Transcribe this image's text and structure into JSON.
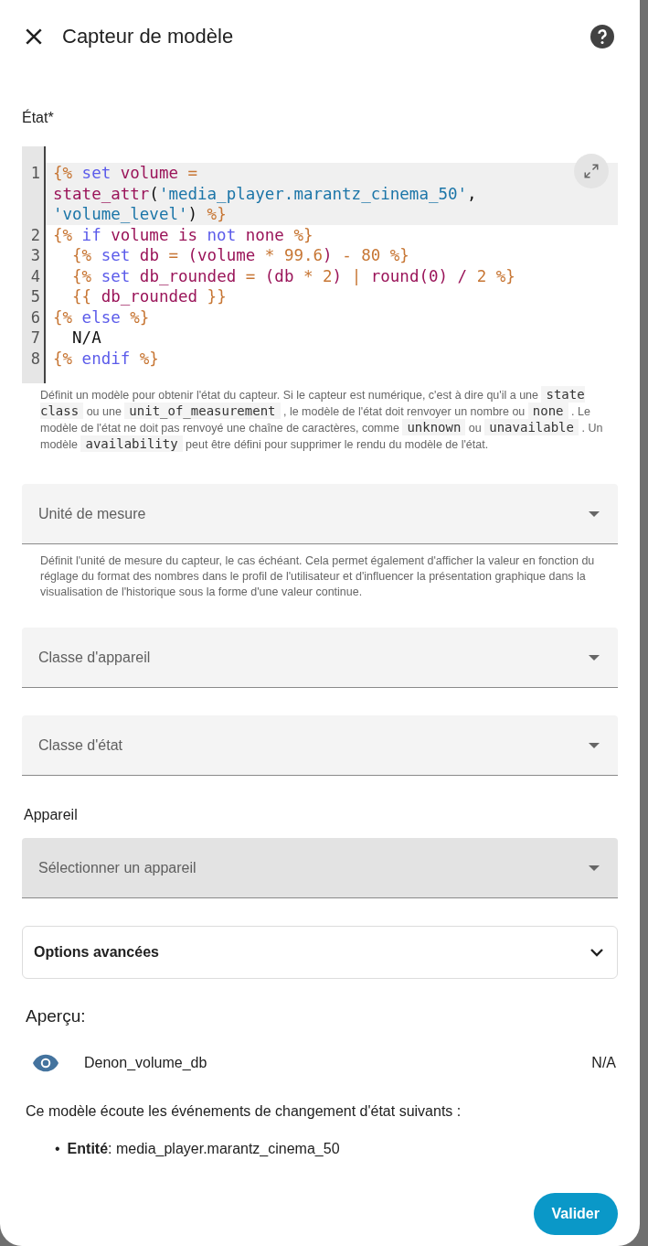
{
  "dialog": {
    "title": "Capteur de modèle"
  },
  "state_field": {
    "label": "État*",
    "code_lines": [
      {
        "number": "1",
        "active": true,
        "tokens": [
          {
            "kind": "brace",
            "text": "{% "
          },
          {
            "kind": "keyword",
            "text": "set "
          },
          {
            "kind": "variable",
            "text": "volume "
          },
          {
            "kind": "operator",
            "text": "= "
          },
          {
            "kind": "variable",
            "text": "state_attr"
          },
          {
            "kind": "plain",
            "text": "("
          },
          {
            "kind": "string",
            "text": "'media_player.marantz_cinema_50'"
          },
          {
            "kind": "plain",
            "text": ", "
          },
          {
            "kind": "string",
            "text": "'volume_level'"
          },
          {
            "kind": "plain",
            "text": ") "
          },
          {
            "kind": "brace",
            "text": "%}"
          }
        ]
      },
      {
        "number": "2",
        "active": false,
        "tokens": [
          {
            "kind": "brace",
            "text": "{% "
          },
          {
            "kind": "keyword",
            "text": "if "
          },
          {
            "kind": "variable",
            "text": "volume is "
          },
          {
            "kind": "keyword",
            "text": "not "
          },
          {
            "kind": "variable",
            "text": "none "
          },
          {
            "kind": "brace",
            "text": "%}"
          }
        ]
      },
      {
        "number": "3",
        "active": false,
        "tokens": [
          {
            "kind": "brace",
            "text": "  {% "
          },
          {
            "kind": "keyword",
            "text": "set "
          },
          {
            "kind": "variable",
            "text": "db "
          },
          {
            "kind": "operator",
            "text": "= "
          },
          {
            "kind": "variable",
            "text": "(volume "
          },
          {
            "kind": "operator",
            "text": "* "
          },
          {
            "kind": "number",
            "text": "99.6"
          },
          {
            "kind": "variable",
            "text": ") "
          },
          {
            "kind": "operator",
            "text": "- "
          },
          {
            "kind": "number",
            "text": "80 "
          },
          {
            "kind": "brace",
            "text": "%}"
          }
        ]
      },
      {
        "number": "4",
        "active": false,
        "tokens": [
          {
            "kind": "brace",
            "text": "  {% "
          },
          {
            "kind": "keyword",
            "text": "set "
          },
          {
            "kind": "variable",
            "text": "db_rounded "
          },
          {
            "kind": "operator",
            "text": "= "
          },
          {
            "kind": "variable",
            "text": "(db "
          },
          {
            "kind": "operator",
            "text": "* "
          },
          {
            "kind": "number",
            "text": "2"
          },
          {
            "kind": "variable",
            "text": ") "
          },
          {
            "kind": "operator",
            "text": "| "
          },
          {
            "kind": "variable",
            "text": "round(0) / "
          },
          {
            "kind": "number",
            "text": "2 "
          },
          {
            "kind": "brace",
            "text": "%}"
          }
        ]
      },
      {
        "number": "5",
        "active": false,
        "tokens": [
          {
            "kind": "brace",
            "text": "  {{ "
          },
          {
            "kind": "variable",
            "text": "db_rounded "
          },
          {
            "kind": "brace",
            "text": "}}"
          }
        ]
      },
      {
        "number": "6",
        "active": false,
        "tokens": [
          {
            "kind": "brace",
            "text": "{% "
          },
          {
            "kind": "keyword",
            "text": "else "
          },
          {
            "kind": "brace",
            "text": "%}"
          }
        ]
      },
      {
        "number": "7",
        "active": false,
        "tokens": [
          {
            "kind": "plain",
            "text": "  N/A"
          }
        ]
      },
      {
        "number": "8",
        "active": false,
        "tokens": [
          {
            "kind": "brace",
            "text": "{% "
          },
          {
            "kind": "keyword",
            "text": "endif "
          },
          {
            "kind": "brace",
            "text": "%}"
          }
        ]
      }
    ],
    "helper": [
      {
        "kind": "text",
        "text": "Définit un modèle pour obtenir l'état du capteur. Si le capteur est numérique, c'est à dire qu'il a une "
      },
      {
        "kind": "code",
        "text": "state class"
      },
      {
        "kind": "text",
        "text": " ou une "
      },
      {
        "kind": "code",
        "text": "unit_of_measurement"
      },
      {
        "kind": "text",
        "text": " , le modèle de l'état doit renvoyer un nombre ou "
      },
      {
        "kind": "code",
        "text": "none"
      },
      {
        "kind": "text",
        "text": " . Le modèle de l'état ne doit pas renvoyé une chaîne de caractères, comme "
      },
      {
        "kind": "code",
        "text": "unknown"
      },
      {
        "kind": "text",
        "text": " ou "
      },
      {
        "kind": "code",
        "text": "unavailable"
      },
      {
        "kind": "text",
        "text": " . Un modèle "
      },
      {
        "kind": "code",
        "text": "availability"
      },
      {
        "kind": "text",
        "text": " peut être défini pour supprimer le rendu du modèle de l'état."
      }
    ]
  },
  "selects": [
    {
      "label": "Unité de mesure",
      "helper": "Définit l'unité de mesure du capteur, le cas échéant. Cela permet également d'afficher la valeur en fonction du réglage du format des nombres dans le profil de l'utilisateur et d'influencer la présentation graphique dans la visualisation de l'historique sous la forme d'une valeur continue."
    },
    {
      "label": "Classe d'appareil"
    },
    {
      "label": "Classe d'état"
    }
  ],
  "device": {
    "heading": "Appareil",
    "placeholder": "Sélectionner un appareil"
  },
  "advanced": {
    "label": "Options avancées",
    "expanded": false
  },
  "preview": {
    "heading": "Aperçu:",
    "entity_name": "Denon_volume_db",
    "entity_state": "N/A",
    "listen_text": "Ce modèle écoute les événements de changement d'état suivants :",
    "listeners": [
      {
        "bullet": "•",
        "text": "**Entité**: media_player.marantz_cinema_50"
      }
    ]
  },
  "submit": "Valider"
}
